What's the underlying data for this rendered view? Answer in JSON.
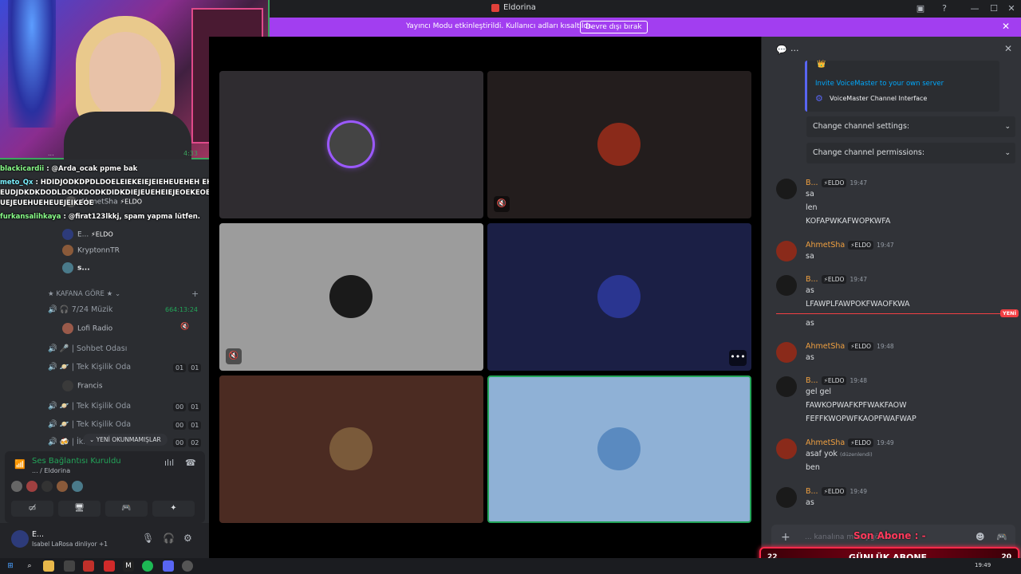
{
  "window": {
    "title": "Eldorina"
  },
  "banner": {
    "message": "Yayıncı Modu etkinleştirildi. Kullanıcı adları kısaltıldı.",
    "button": "Devre dışı bırak"
  },
  "overlay_chat": [
    {
      "user": "blackicardii",
      "text": ": @Arda_ocak ppme bak"
    },
    {
      "user": "meto_Qx",
      "text": ": HDIDJODKDPDLDOELEIEKEIEJEIEHEUEHEH EH EUDJDKDKDODLDODKDODKDIDKDIEJEUEHEIEJEOEKEOELEOEKIEJEUEHEUEHE UEJEUEHUEHEUEJEIKEOE"
    },
    {
      "user": "furkansalihkaya",
      "text": ": @firat123lkkj, spam yapma lütfen."
    }
  ],
  "webcam": {
    "timer": "4:33",
    "bar_text": "..."
  },
  "sidebar": {
    "members_top": [
      {
        "name": "AhmetSha",
        "badge": "⚡ELDO"
      },
      {
        "name": "E...",
        "badge": "⚡ELDO"
      },
      {
        "name": "KryptonnTR",
        "badge": ""
      },
      {
        "name": "s...",
        "badge": ""
      }
    ],
    "category": "★ KAFANA GÖRE ★",
    "channels": [
      {
        "name": "🎧 7/24 Müzik",
        "counter": "664:13:24",
        "members": [
          "Lofi Radio"
        ]
      },
      {
        "name": "🎤 | Sohbet Odası",
        "counter": "",
        "members": []
      },
      {
        "name": "🪐 | Tek Kişilik Oda",
        "c1": "01",
        "c2": "01",
        "members": [
          "Francis"
        ]
      },
      {
        "name": "🪐 | Tek Kişilik Oda",
        "c1": "00",
        "c2": "01",
        "members": []
      },
      {
        "name": "🪐 | Tek Kişilik Oda",
        "c1": "00",
        "c2": "01",
        "members": []
      },
      {
        "name": "🍻 | İki...",
        "c1": "00",
        "c2": "02",
        "members": []
      }
    ],
    "unread_pill": "YENİ OKUNMAMIŞLAR"
  },
  "voice_panel": {
    "status": "Ses Bağlantısı Kuruldu",
    "server": "... / Eldorina"
  },
  "user": {
    "name": "E...",
    "activity": "Isabel LaRosa dinliyor +1"
  },
  "chat": {
    "header_dots": "...",
    "embed": {
      "link": "Invite VoiceMaster to your own server",
      "interface": "VoiceMaster Channel Interface"
    },
    "select1": "Change channel settings:",
    "select2": "Change channel permissions:",
    "messages": [
      {
        "user": "B...",
        "tag": "⚡ELDO",
        "time": "19:47",
        "lines": [
          "sa",
          "len",
          "KOFAPWKAFWOPKWFA"
        ]
      },
      {
        "user": "AhmetSha",
        "tag": "⚡ELDO",
        "time": "19:47",
        "lines": [
          "sa"
        ]
      },
      {
        "user": "B...",
        "tag": "⚡ELDO",
        "time": "19:47",
        "lines": [
          "as",
          "LFAWPLFAWPOKFWAOFKWA",
          "as"
        ]
      },
      {
        "user": "AhmetSha",
        "tag": "⚡ELDO",
        "time": "19:48",
        "lines": [
          "as"
        ]
      },
      {
        "user": "B...",
        "tag": "⚡ELDO",
        "time": "19:48",
        "lines": [
          "gel gel",
          "FAWKOPWAFKPFWAKFAOW",
          "FEFFKWOPWFKAOPFWAFWAP"
        ]
      },
      {
        "user": "AhmetSha",
        "tag": "⚡ELDO",
        "time": "19:49",
        "lines": [
          "asaf yok",
          "ben"
        ],
        "edited": "(düzenlendi)"
      },
      {
        "user": "B...",
        "tag": "⚡ELDO",
        "time": "19:49",
        "lines": [
          "as"
        ]
      }
    ],
    "new_label": "YENİ",
    "composer_placeholder": "... kanalına mesaj gönder"
  },
  "overlays": {
    "son_abone": "Son Abone : -",
    "gunluk": "GÜNLÜK ABONE",
    "left_num": "22",
    "right_num": "20"
  },
  "taskbar": {
    "clock": "19:49"
  }
}
